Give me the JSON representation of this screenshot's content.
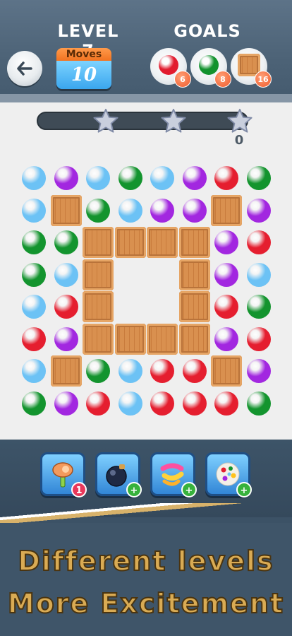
{
  "header": {
    "level_label": "LEVEL 7",
    "goals_label": "GOALS",
    "moves_label": "Moves",
    "moves_value": "10"
  },
  "goals": [
    {
      "type": "red-ball",
      "count": "6",
      "color": "#e21c2f"
    },
    {
      "type": "green-ball",
      "count": "8",
      "color": "#12922e"
    },
    {
      "type": "crate",
      "count": "16",
      "color": "#d9904f"
    }
  ],
  "progress": {
    "score": "0",
    "stars": 3
  },
  "colors": {
    "blue": "#6cc2f5",
    "purple": "#a227e0",
    "green": "#13942e",
    "red": "#e51e2f",
    "crate": "#d9904f"
  },
  "board": [
    [
      "B",
      "P",
      "B",
      "G",
      "B",
      "P",
      "R",
      "G"
    ],
    [
      "B",
      "C",
      "G",
      "B",
      "P",
      "P",
      "C",
      "P"
    ],
    [
      "G",
      "G",
      "C",
      "C",
      "C",
      "C",
      "P",
      "R"
    ],
    [
      "G",
      "B",
      "C",
      ".",
      ".",
      "C",
      "P",
      "B"
    ],
    [
      "B",
      "R",
      "C",
      ".",
      ".",
      "C",
      "R",
      "G"
    ],
    [
      "R",
      "P",
      "C",
      "C",
      "C",
      "C",
      "P",
      "R"
    ],
    [
      "B",
      "C",
      "G",
      "B",
      "R",
      "R",
      "C",
      "P"
    ],
    [
      "G",
      "P",
      "R",
      "B",
      "R",
      "R",
      "R",
      "G"
    ]
  ],
  "tools": [
    {
      "name": "hammer",
      "badge": "1",
      "badge_type": "count"
    },
    {
      "name": "bomb",
      "badge": "+",
      "badge_type": "add"
    },
    {
      "name": "swap",
      "badge": "+",
      "badge_type": "add"
    },
    {
      "name": "color-bomb",
      "badge": "+",
      "badge_type": "add"
    }
  ],
  "promo": {
    "line1": "Different levels",
    "line2": "More Excitement"
  }
}
